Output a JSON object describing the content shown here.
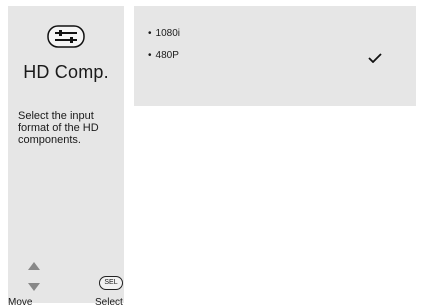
{
  "sidebar": {
    "title": "HD Comp.",
    "description": "Select the input format of the HD components.",
    "icon": "setup-tool-icon",
    "nav": {
      "move_label": "Move",
      "select_label": "Select",
      "sel_badge": "SEL"
    }
  },
  "options": {
    "items": [
      {
        "label": "1080i",
        "selected": false
      },
      {
        "label": "480P",
        "selected": true
      }
    ]
  }
}
